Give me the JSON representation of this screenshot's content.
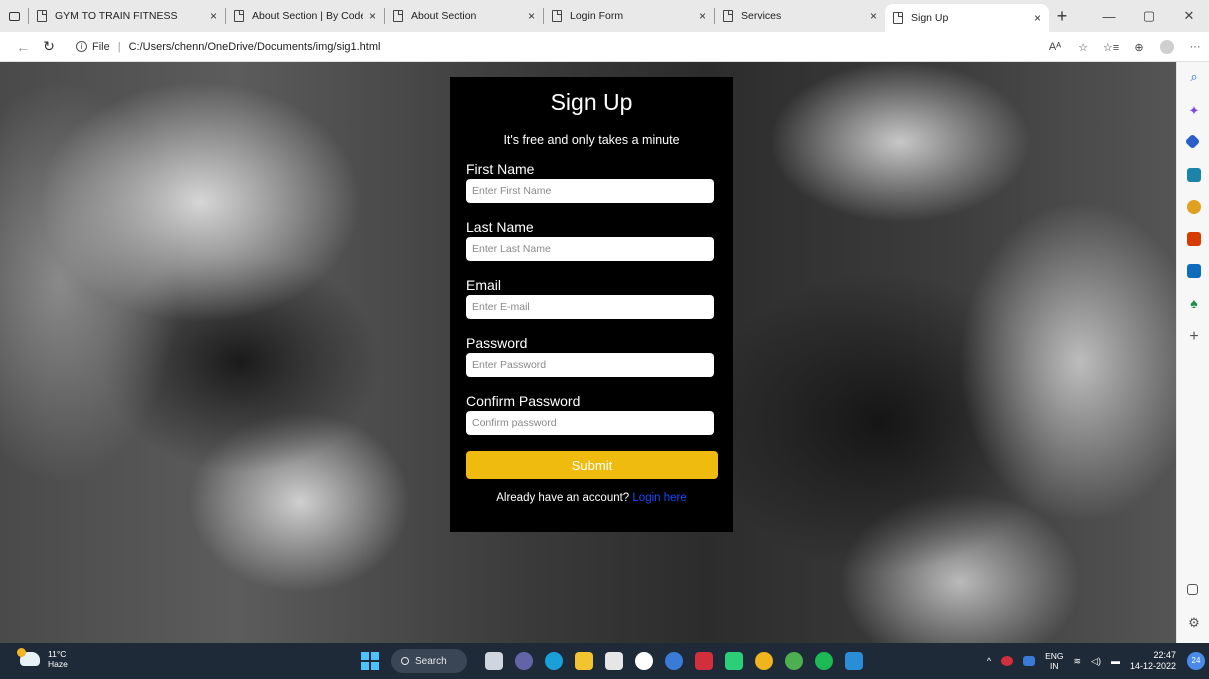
{
  "browser": {
    "tabs": [
      {
        "title": "GYM TO TRAIN FITNESS",
        "close": "×"
      },
      {
        "title": "About Section | By Code Inf",
        "close": "×"
      },
      {
        "title": "About Section",
        "close": "×"
      },
      {
        "title": "Login Form",
        "close": "×"
      },
      {
        "title": "Services",
        "close": "×"
      },
      {
        "title": "Sign Up",
        "close": "×"
      }
    ],
    "new_tab": "+",
    "address": {
      "file_label": "File",
      "separator": "|",
      "url": "C:/Users/chenn/OneDrive/Documents/img/sig1.html"
    },
    "window_controls": {
      "minimize": "—",
      "maximize": "▢",
      "close": "✕"
    },
    "toolbar": {
      "read_aloud": "Aᴬ",
      "favorites": "☆",
      "collections": "⊕",
      "more": "···"
    }
  },
  "form": {
    "title": "Sign Up",
    "subtitle": "It's free and only takes a minute",
    "fields": [
      {
        "label": "First Name",
        "placeholder": "Enter First Name",
        "type": "text"
      },
      {
        "label": "Last Name",
        "placeholder": "Enter Last Name",
        "type": "text"
      },
      {
        "label": "Email",
        "placeholder": "Enter E-mail",
        "type": "email"
      },
      {
        "label": "Password",
        "placeholder": "Enter Password",
        "type": "password"
      },
      {
        "label": "Confirm Password",
        "placeholder": "Confirm password",
        "type": "password"
      }
    ],
    "submit_label": "Submit",
    "login_prompt": "Already have an account?",
    "login_link": "Login here"
  },
  "colors": {
    "card_bg": "#000000",
    "submit_bg": "#eebb0e",
    "link": "#1a4bff",
    "taskbar_bg": "#1f2a38"
  },
  "taskbar": {
    "weather_temp": "11°C",
    "weather_desc": "Haze",
    "search_label": "Search",
    "lang_top": "ENG",
    "lang_bottom": "IN",
    "time": "22:47",
    "date": "14-12-2022",
    "notifications": "24"
  }
}
